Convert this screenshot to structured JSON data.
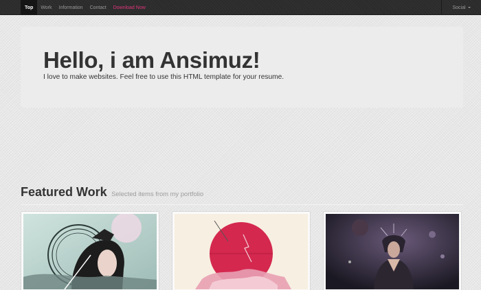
{
  "nav": {
    "items": [
      {
        "label": "Top",
        "active": true
      },
      {
        "label": "Work",
        "active": false
      },
      {
        "label": "Information",
        "active": false
      },
      {
        "label": "Contact",
        "active": false
      },
      {
        "label": "Download Now",
        "active": false
      }
    ],
    "social_label": "Social",
    "accent": "#e0357c"
  },
  "hero": {
    "title": "Hello, i am Ansimuz!",
    "subtitle": "I love to make websites. Feel free to use this HTML template for your resume."
  },
  "featured": {
    "title": "Featured Work",
    "subtitle": "Selected items from my portfolio",
    "thumbnails": [
      {
        "icon": "portrait-artwork-image"
      },
      {
        "icon": "red-sun-artwork-image"
      },
      {
        "icon": "dark-fantasy-artwork-image"
      }
    ]
  }
}
